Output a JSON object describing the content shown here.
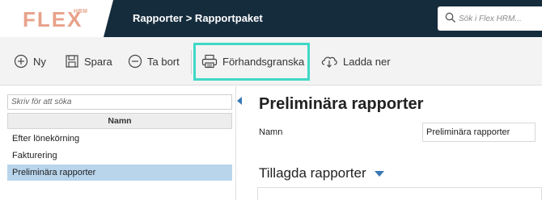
{
  "header": {
    "logo_text": "FLEX",
    "logo_sup": "HRM",
    "breadcrumb": "Rapporter > Rapportpaket",
    "search_placeholder": "Sök i Flex HRM..."
  },
  "toolbar": {
    "new_label": "Ny",
    "save_label": "Spara",
    "delete_label": "Ta bort",
    "preview_label": "Förhandsgranska",
    "download_label": "Ladda ner"
  },
  "left": {
    "filter_placeholder": "Skriv för att söka",
    "column_header": "Namn",
    "items": [
      {
        "label": "Efter lönekörning"
      },
      {
        "label": "Fakturering"
      },
      {
        "label": "Preliminära rapporter",
        "selected": true
      }
    ]
  },
  "main": {
    "title": "Preliminära rapporter",
    "name_label": "Namn",
    "name_value": "Preliminära rapporter",
    "section_title": "Tillagda rapporter"
  },
  "colors": {
    "header_bg": "#152c3d",
    "logo": "#e7a28a",
    "highlight": "#3fd8c6",
    "selected_row": "#b8d5ec",
    "accent": "#3a78b5"
  }
}
